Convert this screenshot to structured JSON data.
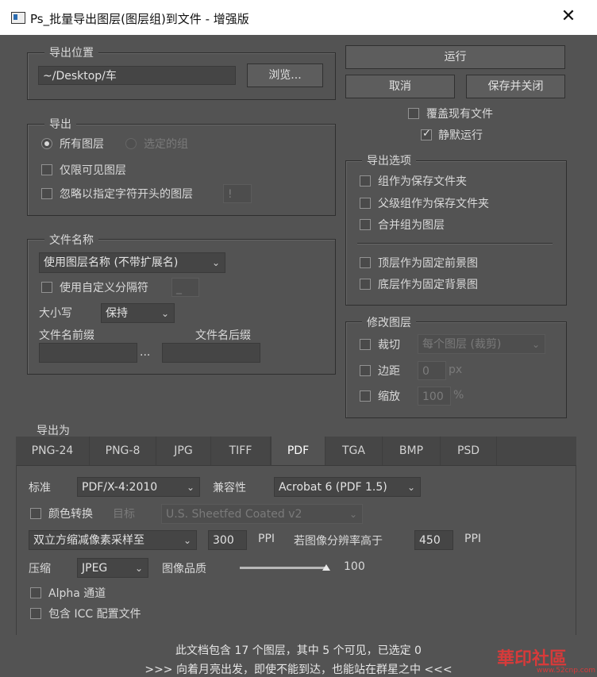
{
  "window": {
    "title": "Ps_批量导出图层(图层组)到文件 - 增强版",
    "close_glyph": "✕"
  },
  "export_location": {
    "legend": "导出位置",
    "path": "~/Desktop/车",
    "browse_label": "浏览..."
  },
  "actions": {
    "run_label": "运行",
    "cancel_label": "取消",
    "save_close_label": "保存并关闭",
    "overwrite_label": "覆盖现有文件",
    "overwrite_checked": false,
    "silent_label": "静默运行",
    "silent_checked": true
  },
  "export": {
    "legend": "导出",
    "all_layers_label": "所有图层",
    "all_layers_selected": true,
    "selected_groups_label": "选定的组",
    "visible_only_label": "仅限可见图层",
    "ignore_prefix_label": "忽略以指定字符开头的图层",
    "ignore_prefix_value": "!"
  },
  "export_options": {
    "legend": "导出选项",
    "items": [
      {
        "label": "组作为保存文件夹",
        "checked": false
      },
      {
        "label": "父级组作为保存文件夹",
        "checked": false
      },
      {
        "label": "合并组为图层",
        "checked": false
      },
      {
        "label": "顶层作为固定前景图",
        "checked": false
      },
      {
        "label": "底层作为固定背景图",
        "checked": false
      }
    ]
  },
  "filename": {
    "legend": "文件名称",
    "naming_mode": "使用图层名称 (不带扩展名)",
    "custom_sep_label": "使用自定义分隔符",
    "custom_sep_value": "_",
    "case_label": "大小写",
    "case_value": "保持",
    "prefix_label": "文件名前缀",
    "suffix_label": "文件名后缀",
    "ellipsis": "...",
    "prefix_value": "",
    "suffix_value": ""
  },
  "modify_layers": {
    "legend": "修改图层",
    "crop_label": "裁切",
    "crop_value": "每个图层 (裁剪)",
    "margin_label": "边距",
    "margin_value": "0",
    "margin_unit": "px",
    "scale_label": "缩放",
    "scale_value": "100",
    "scale_unit": "%"
  },
  "export_as": {
    "legend": "导出为",
    "tabs": [
      "PNG-24",
      "PNG-8",
      "JPG",
      "TIFF",
      "PDF",
      "TGA",
      "BMP",
      "PSD"
    ],
    "active_tab": "PDF"
  },
  "pdf": {
    "standard_label": "标准",
    "standard_value": "PDF/X-4:2010",
    "compat_label": "兼容性",
    "compat_value": "Acrobat 6 (PDF 1.5)",
    "color_conv_label": "颜色转换",
    "target_label": "目标",
    "target_value": "U.S. Sheetfed Coated v2",
    "downsample_value": "双立方缩减像素采样至",
    "downsample_ppi": "300",
    "ppi_unit": "PPI",
    "threshold_label": "若图像分辨率高于",
    "threshold_ppi": "450",
    "compression_label": "压缩",
    "compression_value": "JPEG",
    "quality_label": "图像品质",
    "quality_value": "100",
    "quality_fraction": 1.0,
    "alpha_label": "Alpha 通道",
    "icc_label": "包含 ICC 配置文件"
  },
  "footer": {
    "status": "此文档包含 17 个图层，其中 5 个可见，已选定 0",
    "motto": ">>> 向着月亮出发，即使不能到达，也能站在群星之中 <<<"
  },
  "watermark": {
    "text": "華印社區",
    "url": "www.52cnp.com"
  },
  "colors": {
    "bg": "#535353",
    "field": "#454545",
    "titlebar": "#ffffff",
    "watermark": "#d83a3a"
  }
}
